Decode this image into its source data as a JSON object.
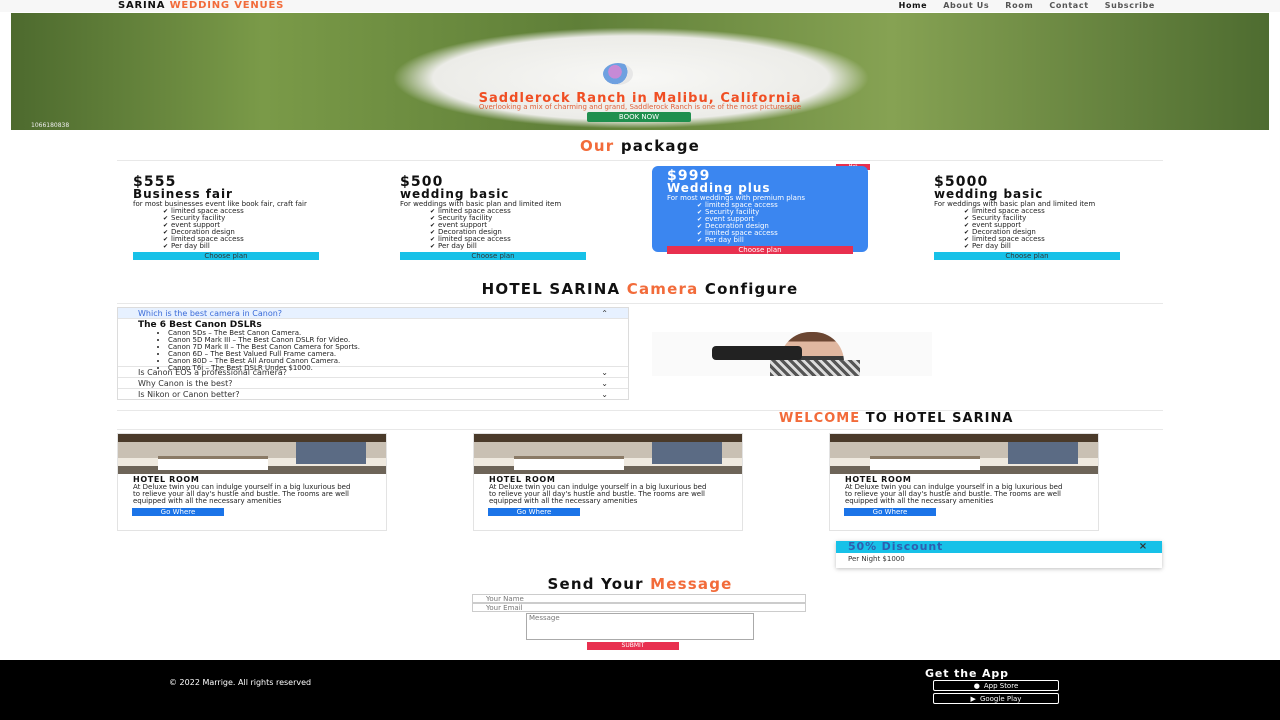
{
  "nav": {
    "brand_main": "SARINA",
    "brand_accent": "WEDDING VENUES",
    "links": [
      "Home",
      "About Us",
      "Room",
      "Contact",
      "Subscribe"
    ]
  },
  "hero": {
    "title": "Saddlerock Ranch in Malibu, California",
    "subtitle": "Overlooking a mix of charming and grand, Saddlerock Ranch is one of the most picturesque",
    "button": "BOOK NOW",
    "credit": "1066180838"
  },
  "packages": {
    "heading_accent": "Our",
    "heading_rest": "package",
    "hot_badge": "Hot",
    "items": [
      {
        "price": "$555",
        "name": "Business fair",
        "desc": "for most businesses event like book fair, craft fair",
        "features": [
          "limited space access",
          "Security facility",
          "event support",
          "Decoration design",
          "limited space access",
          "Per day bill"
        ],
        "button": "Choose plan"
      },
      {
        "price": "$500",
        "name": "wedding basic",
        "desc": "For weddings with basic plan and limited item",
        "features": [
          "limited space access",
          "Security facility",
          "event support",
          "Decoration design",
          "limited space access",
          "Per day bill"
        ],
        "button": "Choose plan"
      },
      {
        "price": "$999",
        "name": "Wedding plus",
        "desc": "For most weddings with premium plans",
        "features": [
          "limited space access",
          "Security facility",
          "event support",
          "Decoration design",
          "limited space access",
          "Per day bill"
        ],
        "button": "Choose plan"
      },
      {
        "price": "$5000",
        "name": "wedding basic",
        "desc": "For weddings with basic plan and limited item",
        "features": [
          "limited space access",
          "Security facility",
          "event support",
          "Decoration design",
          "limited space access",
          "Per day bill"
        ],
        "button": "Choose plan"
      }
    ]
  },
  "camera": {
    "heading_pre": "HOTEL SARINA",
    "heading_accent": "Camera",
    "heading_post": "Configure",
    "accordion": [
      {
        "q": "Which is the best camera in Canon?",
        "open": true
      },
      {
        "q": "Is Canon EOS a professional camera?",
        "open": false
      },
      {
        "q": "Why Canon is the best?",
        "open": false
      },
      {
        "q": "Is Nikon or Canon better?",
        "open": false
      }
    ],
    "answer_title": "The 6 Best Canon DSLRs",
    "answer_items": [
      "Canon 5Ds – The Best Canon Camera.",
      "Canon 5D Mark III – The Best Canon DSLR for Video.",
      "Canon 7D Mark II – The Best Canon Camera for Sports.",
      "Canon 6D – The Best Valued Full Frame camera.",
      "Canon 80D – The Best All Around Canon Camera.",
      "Canon T6i – The Best DSLR Under $1000."
    ]
  },
  "welcome": {
    "accent": "WELCOME",
    "rest": "TO HOTEL SARINA"
  },
  "rooms": [
    {
      "title": "HOTEL ROOM",
      "desc": "At Deluxe twin you can indulge yourself in a big luxurious bed to relieve your all day's hustle and bustle. The rooms are well equipped with all the necessary amenities",
      "button": "Go Where"
    },
    {
      "title": "HOTEL ROOM",
      "desc": "At Deluxe twin you can indulge yourself in a big luxurious bed to relieve your all day's hustle and bustle. The rooms are well equipped with all the necessary amenities",
      "button": "Go Where"
    },
    {
      "title": "HOTEL ROOM",
      "desc": "At Deluxe twin you can indulge yourself in a big luxurious bed to relieve your all day's hustle and bustle. The rooms are well equipped with all the necessary amenities",
      "button": "Go Where"
    }
  ],
  "discount": {
    "title": "50% Discount",
    "close": "×",
    "body": "Per Night $1000"
  },
  "message": {
    "heading_pre": "Send Your",
    "heading_accent": "Message",
    "name_placeholder": "Your Name",
    "email_placeholder": "Your Email",
    "message_placeholder": "Message",
    "submit": "SUBMIT"
  },
  "footer": {
    "copyright": "© 2022 Marrige. All rights reserved",
    "app_title": "Get the App",
    "app_store": "App Store",
    "google_play": "Google Play"
  },
  "colors": {
    "accent": "#f26b3a",
    "featured": "#3b86f0",
    "cyan": "#17c1e8",
    "red": "#e8304f",
    "book": "#1f8f4e"
  }
}
